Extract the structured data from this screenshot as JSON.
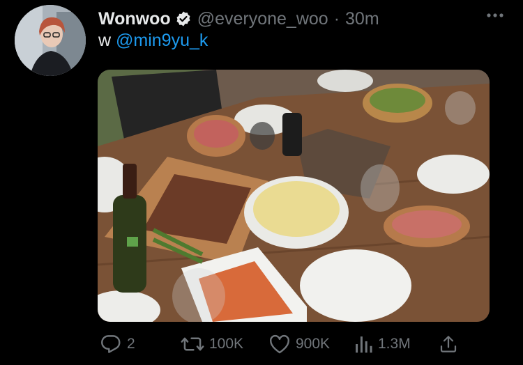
{
  "tweet": {
    "author_name": "Wonwoo",
    "author_handle": "@everyone_woo",
    "separator": "·",
    "time": "30m",
    "text_prefix": "w",
    "mention": "@min9yu_k"
  },
  "stats": {
    "replies": "2",
    "retweets": "100K",
    "likes": "900K",
    "views": "1.3M"
  },
  "icons": {
    "verified": "verified-badge-icon",
    "more": "more-dots-icon",
    "reply": "reply-icon",
    "retweet": "retweet-icon",
    "like": "heart-icon",
    "views": "views-bar-chart-icon",
    "share": "share-icon"
  },
  "colors": {
    "background": "#000000",
    "text": "#e7e9ea",
    "secondary": "#71767b",
    "accent": "#1d9bf0"
  }
}
